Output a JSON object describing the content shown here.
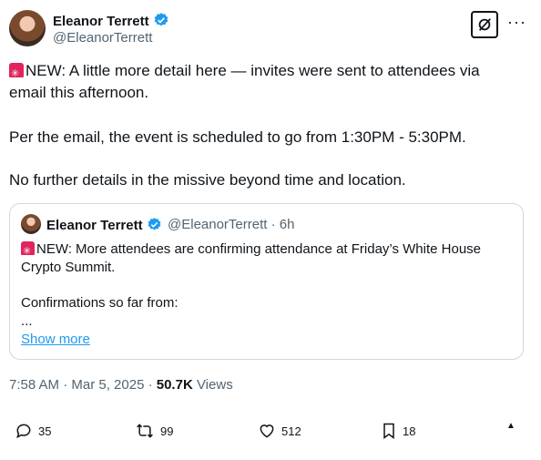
{
  "author": {
    "name": "Eleanor Terrett",
    "handle": "@EleanorTerrett"
  },
  "tweet": {
    "line1": "NEW: A little more detail here — invites were sent to attendees via",
    "line2": "email this afternoon.",
    "para2": "Per the email, the event is scheduled to go from 1:30PM - 5:30PM.",
    "para3": "No further details in the missive beyond time and location."
  },
  "quote": {
    "name": "Eleanor Terrett",
    "handle_time": "@EleanorTerrett · 6h",
    "line1": "NEW: More attendees are confirming attendance at Friday’s White House",
    "line2": "Crypto Summit.",
    "line3": "Confirmations so far from:",
    "ellipsis": "...",
    "show_more": "Show more"
  },
  "meta": {
    "datetime": "7:58 AM · Mar 5, 2025 · ",
    "views_count": "50.7K",
    "views_label": " Views"
  },
  "actions": {
    "replies": "35",
    "reposts": "99",
    "likes": "512",
    "bookmarks": "18"
  },
  "icons": [
    "verified-badge-icon",
    "grok-icon",
    "more-options-icon",
    "siren-emoji-icon",
    "reply-icon",
    "repost-icon",
    "like-icon",
    "bookmark-icon",
    "share-icon"
  ],
  "colors": {
    "accent": "#1d9bf0",
    "secondary_text": "#536471",
    "siren": "#e0245e"
  }
}
